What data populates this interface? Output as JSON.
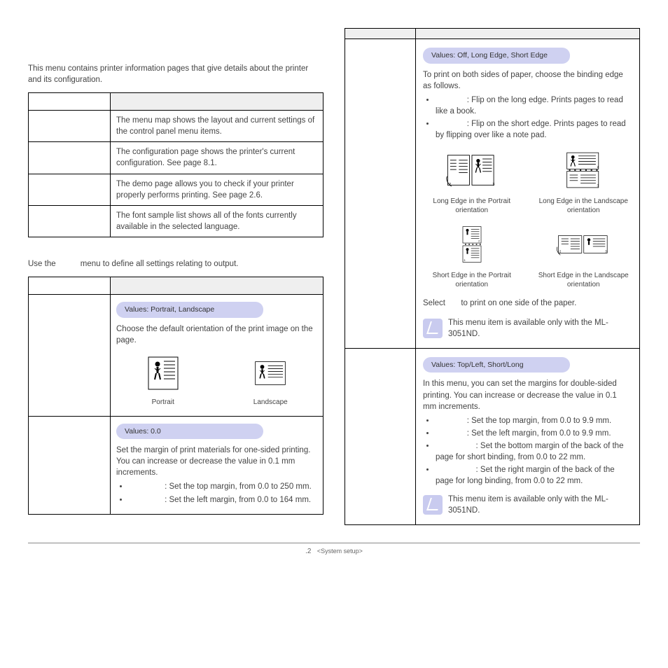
{
  "left": {
    "intro": "This menu contains printer information pages that give details about the printer and its configuration.",
    "table1": [
      "The menu map shows the layout and current settings of the control panel menu items.",
      "The configuration page shows the printer's current configuration. See page 8.1.",
      "The demo page allows you to check if your printer properly performs printing. See page 2.6.",
      "The font sample list shows all of the fonts currently available in the selected language."
    ],
    "layout_intro_a": "Use the",
    "layout_intro_b": "menu to define all settings relating to output.",
    "orientation": {
      "values": "Values: Portrait, Landscape",
      "desc": "Choose the default orientation of the print image on the page.",
      "cap_portrait": "Portrait",
      "cap_landscape": "Landscape"
    },
    "margin": {
      "values": "Values: 0.0",
      "desc": "Set the margin of print materials for one-sided printing. You can increase or decrease the value in 0.1 mm increments.",
      "li1": ": Set the top margin, from 0.0 to 250 mm.",
      "li2": ": Set the left margin, from 0.0 to 164 mm."
    }
  },
  "right": {
    "duplex": {
      "values": "Values: Off, Long Edge, Short Edge",
      "desc": "To print on both sides of paper, choose the binding edge as follows.",
      "li1": ": Flip on the long edge. Prints pages to read like a book.",
      "li2": ": Flip on the short edge. Prints pages to read by flipping over like a note pad.",
      "cap1": "Long Edge in the Portrait orientation",
      "cap2": "Long Edge in the Landscape orientation",
      "cap3": "Short Edge in the Portrait orientation",
      "cap4": "Short Edge in the Landscape orientation",
      "select_a": "Select",
      "select_b": "to print on one side of the paper.",
      "note": "This menu item is available only with the ML-3051ND."
    },
    "dmargin": {
      "values": "Values: Top/Left, Short/Long",
      "desc": "In this menu, you can set the margins for double-sided printing. You can increase or decrease the value in 0.1 mm increments.",
      "li1": ": Set the top margin, from 0.0 to 9.9 mm.",
      "li2": ": Set the left margin, from 0.0 to 9.9 mm.",
      "li3": ": Set the bottom margin of the back of the page for short binding, from 0.0 to 22 mm.",
      "li4": ": Set the right margin of the back of the page for long binding, from 0.0 to 22 mm.",
      "note": "This menu item is available only with the ML-3051ND."
    }
  },
  "footer_num": ".2",
  "footer_label": "<System setup>"
}
